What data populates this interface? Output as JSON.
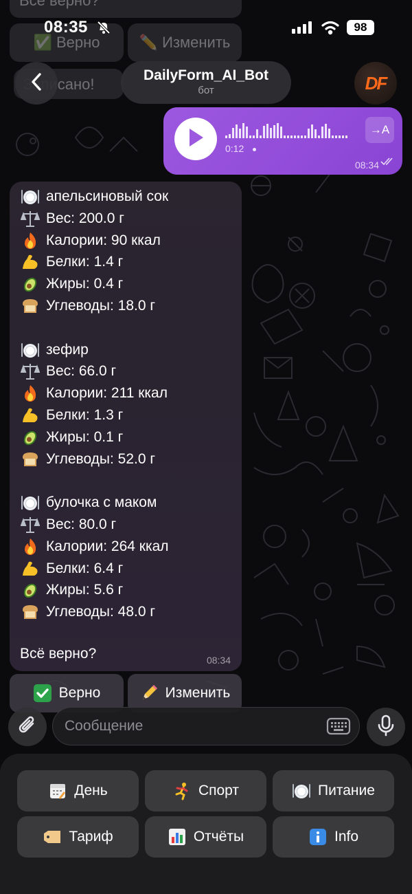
{
  "status_bar": {
    "time": "08:35",
    "battery": "98",
    "icons": [
      "bell-off-icon",
      "signal-icon",
      "wifi-icon",
      "battery-icon"
    ]
  },
  "header": {
    "bot_name": "DailyForm_AI_Bot",
    "bot_subtitle": "бот",
    "avatar_text": "DF",
    "back_icon": "chevron-left-icon"
  },
  "background_messages": {
    "question": "Всё верно?",
    "confirm": "✅ Верно",
    "edit": "✏️ Изменить",
    "saved": "Записано!"
  },
  "voice_message": {
    "duration": "0:12",
    "time": "08:34",
    "transcribe_label": "→A",
    "status": "read"
  },
  "bot_message": {
    "items": [
      {
        "name": "апельсиновый сок",
        "weight": "Вес: 200.0 г",
        "calories": "Калории: 90 ккал",
        "protein": "Белки: 1.4 г",
        "fat": "Жиры: 0.4 г",
        "carbs": "Углеводы: 18.0 г"
      },
      {
        "name": "зефир",
        "weight": "Вес: 66.0 г",
        "calories": "Калории: 211 ккал",
        "protein": "Белки: 1.3 г",
        "fat": "Жиры: 0.1 г",
        "carbs": "Углеводы: 52.0 г"
      },
      {
        "name": "булочка с маком",
        "weight": "Вес: 80.0 г",
        "calories": "Калории: 264 ккал",
        "protein": "Белки: 6.4 г",
        "fat": "Жиры: 5.6 г",
        "carbs": "Углеводы: 48.0 г"
      }
    ],
    "question": "Всё верно?",
    "time": "08:34"
  },
  "inline_keyboard": {
    "confirm_label": "Верно",
    "edit_label": "Изменить"
  },
  "composer": {
    "placeholder": "Сообщение"
  },
  "reply_keyboard": {
    "buttons": [
      {
        "label": "День",
        "icon": "calendar-icon"
      },
      {
        "label": "Спорт",
        "icon": "runner-icon"
      },
      {
        "label": "Питание",
        "icon": "plate-icon"
      },
      {
        "label": "Тариф",
        "icon": "tag-icon"
      },
      {
        "label": "Отчёты",
        "icon": "bar-chart-icon"
      },
      {
        "label": "Info",
        "icon": "info-icon"
      }
    ]
  },
  "colors": {
    "voice_bubble": "#9d58e0",
    "bot_bubble": "#2b2530",
    "keyboard_bg": "#1c1c1e",
    "keyboard_button": "#3a3a3c",
    "avatar_accent": "#ff6a1a"
  }
}
